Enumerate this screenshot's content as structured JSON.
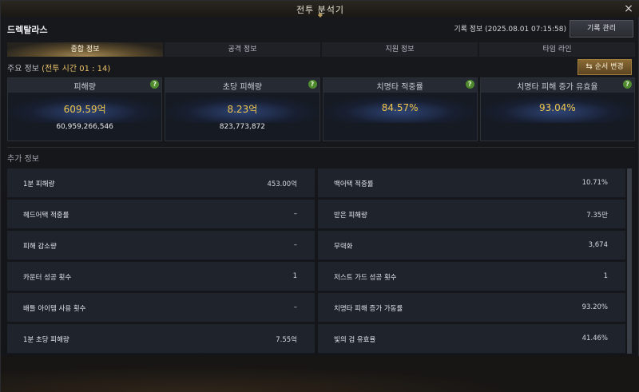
{
  "window": {
    "title": "전투 분석기",
    "close_icon": "×"
  },
  "header": {
    "character_name": "드렉탈라스",
    "record_info": "기록 정보 (2025.08.01 07:15:58)",
    "record_manage_label": "기록 관리"
  },
  "tabs": [
    {
      "label": "종합 정보",
      "active": true
    },
    {
      "label": "공격 정보",
      "active": false
    },
    {
      "label": "지원 정보",
      "active": false
    },
    {
      "label": "타임 라인",
      "active": false
    }
  ],
  "main_info": {
    "label": "주요 정보",
    "battle_time": "(전투 시간 01 : 14)",
    "order_change_label": "순서 변경"
  },
  "stat_cards": [
    {
      "title": "피해량",
      "value": "609.59억",
      "sub": "60,959,266,546"
    },
    {
      "title": "초당 피해량",
      "value": "8.23억",
      "sub": "823,773,872"
    },
    {
      "title": "치명타 적중률",
      "value": "84.57%",
      "sub": ""
    },
    {
      "title": "치명타 피해 증가 유효율",
      "value": "93.04%",
      "sub": ""
    }
  ],
  "extra_info": {
    "label": "추가 정보",
    "rows": [
      {
        "label": "1분 피해량",
        "value": "453.00억"
      },
      {
        "label": "백어택 적중률",
        "value": "10.71%"
      },
      {
        "label": "헤드어택 적중률",
        "value": "–"
      },
      {
        "label": "받은 피해량",
        "value": "7.35만"
      },
      {
        "label": "피해 감소량",
        "value": "–"
      },
      {
        "label": "무력화",
        "value": "3,674"
      },
      {
        "label": "카운터 성공 횟수",
        "value": "1"
      },
      {
        "label": "저스트 가드 성공 횟수",
        "value": "1"
      },
      {
        "label": "배틀 아이템 사용 횟수",
        "value": "–"
      },
      {
        "label": "치명타 피해 증가 가동률",
        "value": "93.20%"
      },
      {
        "label": "1분 초당 피해량",
        "value": "7.55억"
      },
      {
        "label": "빛의 검 유효율",
        "value": "41.46%"
      }
    ]
  },
  "colors": {
    "accent_gold": "#f0c64c",
    "help_green": "#4f8a2f",
    "order_button": "#8a6a34"
  }
}
